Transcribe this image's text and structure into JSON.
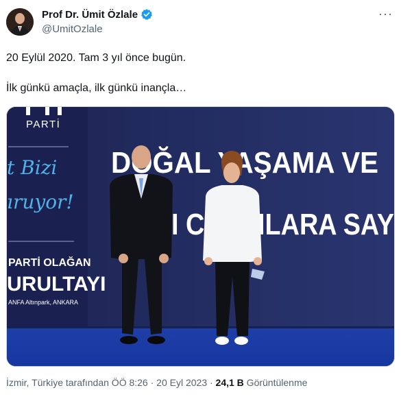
{
  "author": {
    "display_name": "Prof Dr. Ümit Özlale",
    "handle": "@UmitOzlale",
    "verified": true,
    "verified_color": "#1d9bf0"
  },
  "more_icon": "more-horizontal-icon",
  "tweet": {
    "line1": "20 Eylül 2020. Tam 3 yıl önce bugün.",
    "line2": "İlk günkü amaçla, ilk günkü inançla…"
  },
  "media": {
    "banner_top": "PARTİ",
    "script_line1": "t Bizi",
    "script_line2": "ıruyor!",
    "left_line1": "PARTİ OLAĞAN",
    "left_line2": "URULTAYI",
    "left_line3": "ANFA Altınpark, ANKARA",
    "right_line1": "DOĞAL YAŞAMA VE",
    "right_line2": "I CANLILARA SAY"
  },
  "meta": {
    "location_time": "İzmir, Türkiye tarafından ÖÖ 8:26 · 20 Eyl 2023 · ",
    "views_count": "24,1 B",
    "views_label": " Görüntülenme"
  }
}
